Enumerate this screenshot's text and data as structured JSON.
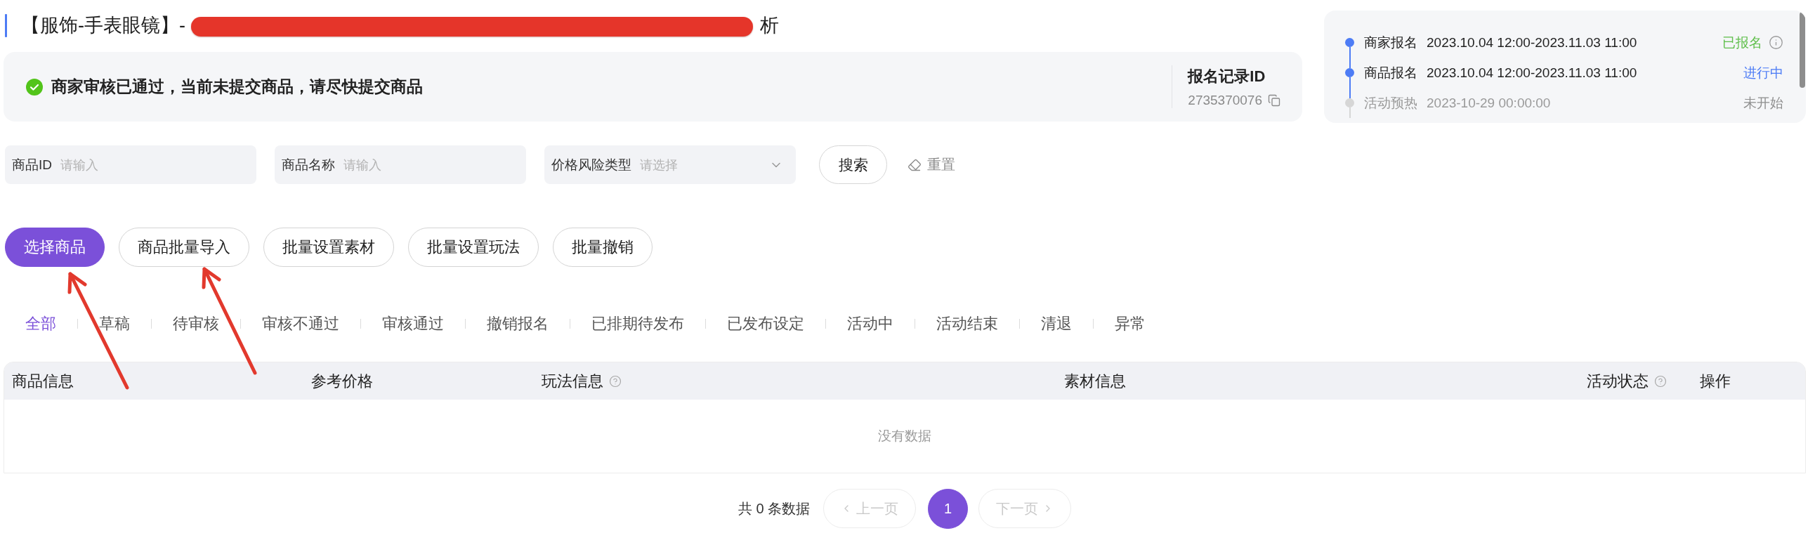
{
  "title": {
    "visible_start": "【服饰-手表眼镜】-",
    "redacted": true,
    "visible_end": "析"
  },
  "notice": {
    "message": "商家审核已通过，当前未提交商品，请尽快提交商品",
    "record_label": "报名记录ID",
    "record_id": "2735370076"
  },
  "timeline": [
    {
      "label": "商家报名",
      "time": "2023.10.04 12:00-2023.11.03 11:00",
      "status": "已报名",
      "kind": "done",
      "has_info": true
    },
    {
      "label": "商品报名",
      "time": "2023.10.04 12:00-2023.11.03 11:00",
      "status": "进行中",
      "kind": "active",
      "has_info": false
    },
    {
      "label": "活动预热",
      "time": "2023-10-29 00:00:00",
      "status": "未开始",
      "kind": "pending",
      "has_info": false
    }
  ],
  "filters": [
    {
      "kind": "input",
      "label": "商品ID",
      "placeholder": "请输入"
    },
    {
      "kind": "input",
      "label": "商品名称",
      "placeholder": "请输入"
    },
    {
      "kind": "select",
      "label": "价格风险类型",
      "placeholder": "请选择"
    }
  ],
  "search_button": "搜索",
  "reset_button": "重置",
  "actions": [
    {
      "label": "选择商品",
      "primary": true
    },
    {
      "label": "商品批量导入",
      "primary": false
    },
    {
      "label": "批量设置素材",
      "primary": false
    },
    {
      "label": "批量设置玩法",
      "primary": false
    },
    {
      "label": "批量撤销",
      "primary": false
    }
  ],
  "tabs": [
    {
      "label": "全部",
      "selected": true
    },
    {
      "label": "草稿",
      "selected": false
    },
    {
      "label": "待审核",
      "selected": false
    },
    {
      "label": "审核不通过",
      "selected": false
    },
    {
      "label": "审核通过",
      "selected": false
    },
    {
      "label": "撤销报名",
      "selected": false
    },
    {
      "label": "已排期待发布",
      "selected": false
    },
    {
      "label": "已发布设定",
      "selected": false
    },
    {
      "label": "活动中",
      "selected": false
    },
    {
      "label": "活动结束",
      "selected": false
    },
    {
      "label": "清退",
      "selected": false
    },
    {
      "label": "异常",
      "selected": false
    }
  ],
  "table": {
    "columns": [
      {
        "label": "商品信息",
        "help": false
      },
      {
        "label": "参考价格",
        "help": false
      },
      {
        "label": "玩法信息",
        "help": true
      },
      {
        "label": "素材信息",
        "help": false
      },
      {
        "label": "活动状态",
        "help": true
      },
      {
        "label": "操作",
        "help": false
      }
    ],
    "empty_text": "没有数据"
  },
  "pagination": {
    "total_text": "共 0 条数据",
    "prev": {
      "label": "上一页",
      "disabled": true
    },
    "pages": [
      {
        "label": "1",
        "selected": true
      }
    ],
    "next": {
      "label": "下一页",
      "disabled": true
    }
  }
}
